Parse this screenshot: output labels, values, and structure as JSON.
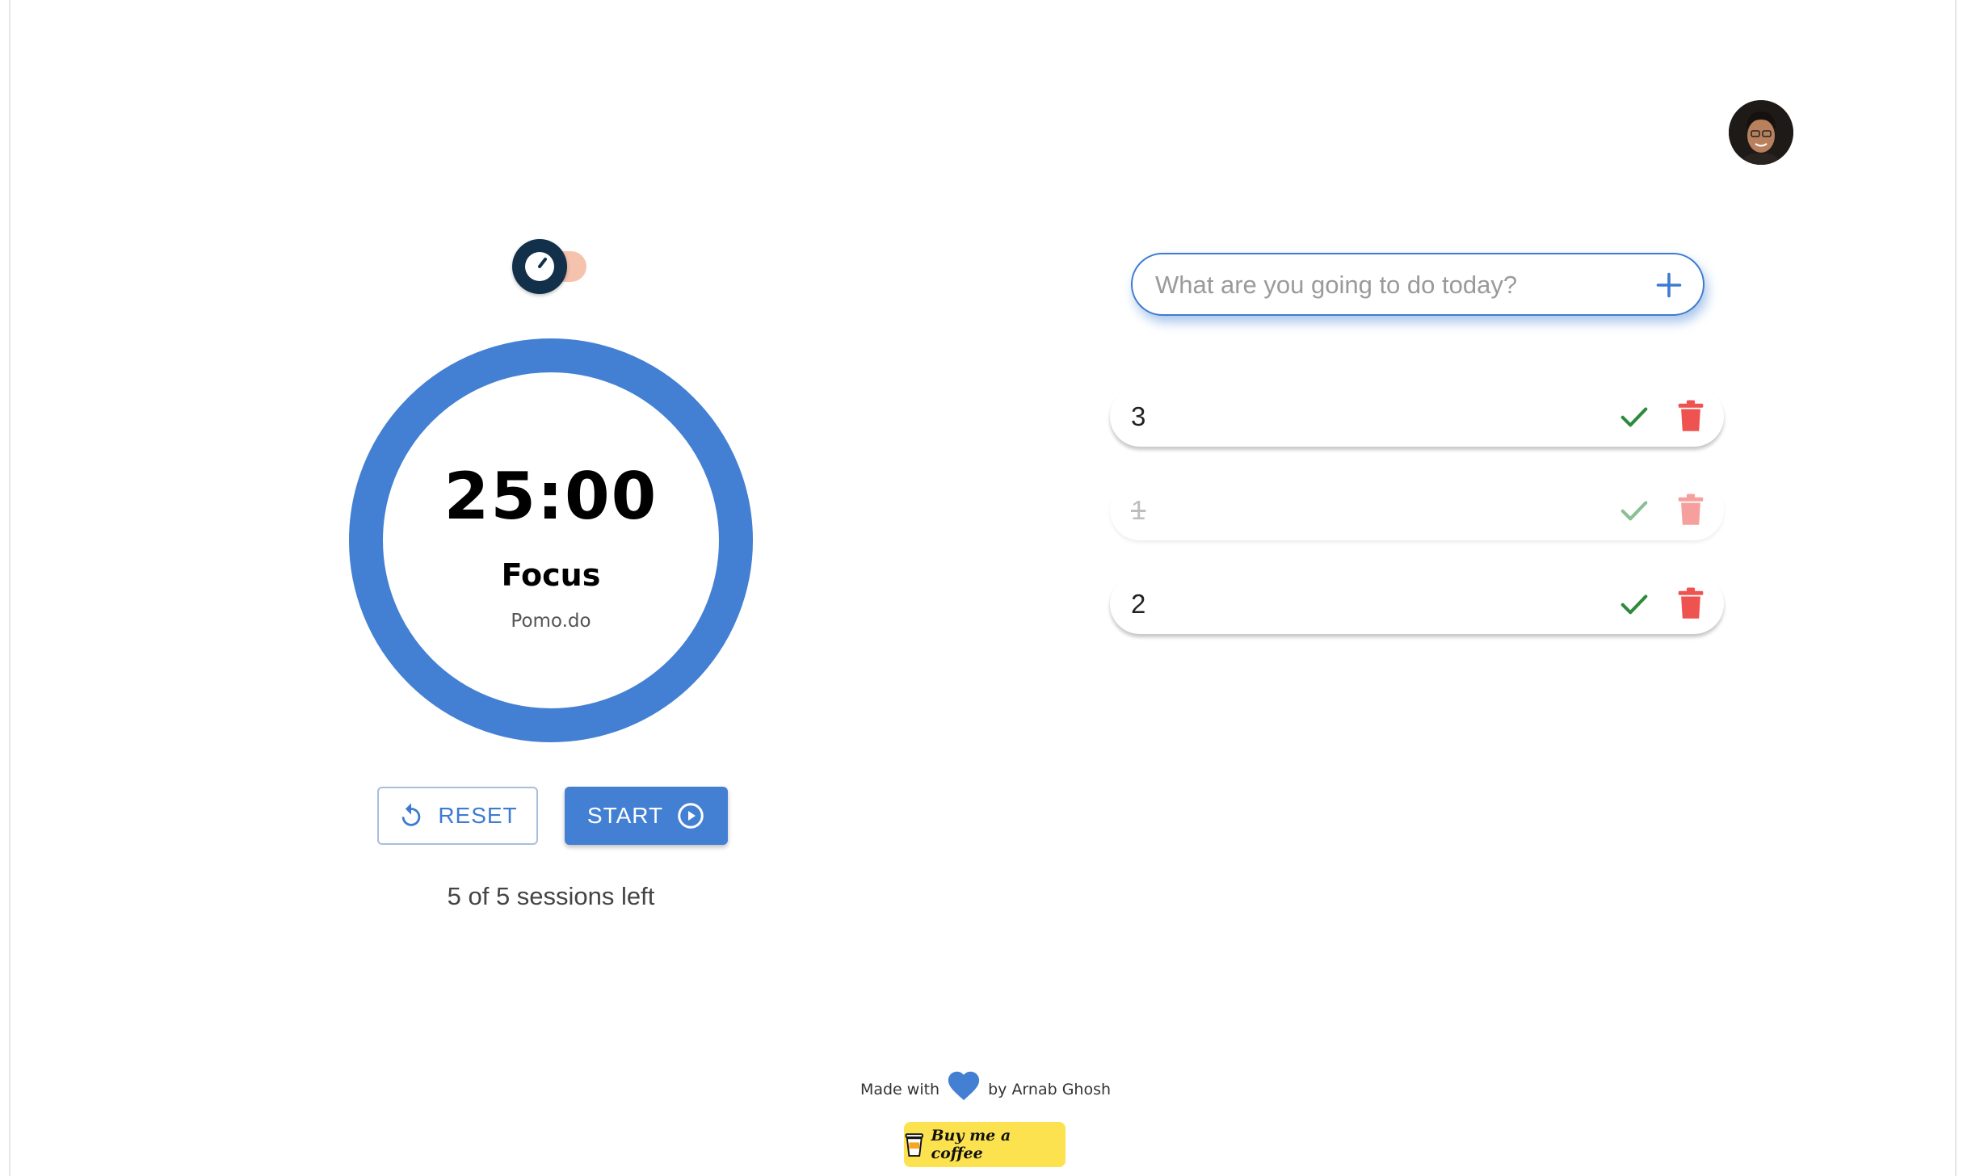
{
  "profile": {
    "avatar_alt": "Profile"
  },
  "timer": {
    "time": "25:00",
    "mode": "Focus",
    "app_name": "Pomo.do",
    "ring_color": "#4380d3",
    "progress": 1.0
  },
  "controls": {
    "reset_label": "RESET",
    "start_label": "START"
  },
  "sessions_text": "5 of 5 sessions left",
  "todo": {
    "placeholder": "What are you going to do today?",
    "items": [
      {
        "text": "3",
        "done": false
      },
      {
        "text": "1",
        "done": true
      },
      {
        "text": "2",
        "done": false
      }
    ]
  },
  "footer": {
    "made_with": "Made with",
    "by": "by Arnab Ghosh",
    "coffee_label": "Buy me a coffee"
  },
  "colors": {
    "accent": "#4380d3",
    "check": "#2e8b3e",
    "delete": "#ef5350",
    "coffee": "#fde24f",
    "toggle_knob": "#13304a",
    "toggle_track": "#f5c3ad"
  },
  "icons": [
    "avatar",
    "timer-icon",
    "reset-icon",
    "play-circle-icon",
    "plus-icon",
    "check-icon",
    "trash-icon",
    "heart-icon",
    "coffee-cup-icon"
  ]
}
